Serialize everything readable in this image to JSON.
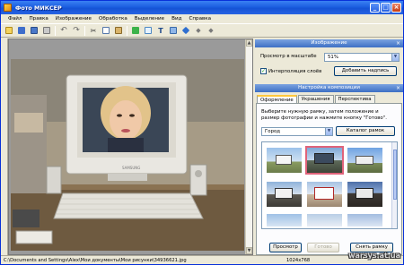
{
  "window": {
    "title": "Фото МИКСЕР"
  },
  "menu": [
    "Файл",
    "Правка",
    "Изображение",
    "Обработка",
    "Выделение",
    "Вид",
    "Справка"
  ],
  "toolbar_icons": [
    "new-file-icon",
    "open-folder-icon",
    "save-icon",
    "print-icon",
    "undo-icon",
    "redo-icon",
    "cut-icon",
    "copy-icon",
    "paste-icon",
    "layers-icon",
    "frame-icon",
    "text-icon",
    "mask-icon",
    "brush-icon",
    "arrow-left-icon",
    "arrow-right-icon"
  ],
  "image_panel": {
    "header": "Изображение",
    "scale_label": "Просмотр в масштабе",
    "scale_value": "51%",
    "interpolation_label": "Интерполяция слоёв",
    "interpolation_checked": true,
    "add_caption_button": "Добавить надпись"
  },
  "composition_panel": {
    "header": "Настройка композиции",
    "tabs": [
      "Оформление",
      "Украшения",
      "Перспектива"
    ],
    "active_tab": "Оформление",
    "instructions": "Выберите нужную рамку, затем положение и размер фотографии и нажмите кнопку \"Готово\".",
    "category_value": "Город",
    "catalog_button": "Каталог рамок",
    "preview_button": "Просмотр",
    "ready_button": "Готово",
    "remove_frame_button": "Снять рамку"
  },
  "status": {
    "path": "C:\\Documents and Settings\\Alex\\Мои документы\\Мои рисунки\\34936621.jpg",
    "size": "1024x768"
  },
  "watermark": "warsys.at.ua",
  "colors": {
    "titlebar": "#1c5fe0",
    "accent": "#3d6fc4",
    "selected_thumb": "#e0637a"
  }
}
